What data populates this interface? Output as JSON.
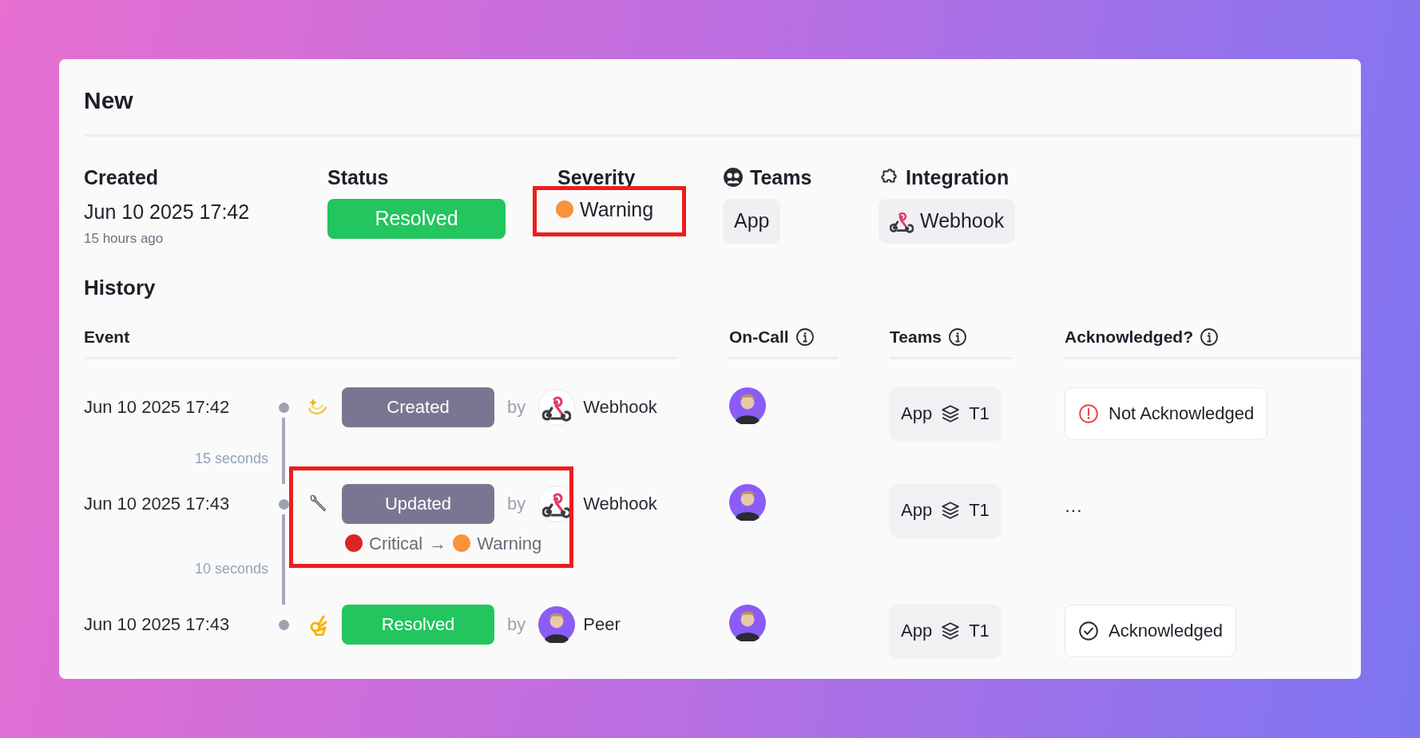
{
  "title": "New",
  "summary": {
    "created": {
      "label": "Created",
      "value": "Jun 10 2025 17:42",
      "relative": "15 hours ago"
    },
    "status": {
      "label": "Status",
      "value": "Resolved",
      "kind": "resolved"
    },
    "severity": {
      "label": "Severity",
      "value": "Warning",
      "color": "#fb923c",
      "highlighted": true
    },
    "teams": {
      "label": "Teams",
      "items": [
        "App"
      ]
    },
    "integration": {
      "label": "Integration",
      "value": "Webhook"
    }
  },
  "history": {
    "title": "History",
    "columns": [
      "Event",
      "On-Call",
      "Teams",
      "Acknowledged?"
    ],
    "events": [
      {
        "time": "Jun 10 2025 17:42",
        "kind": "created",
        "label": "Created",
        "by": "by",
        "actor": {
          "name": "Webhook",
          "kind": "webhook"
        },
        "team": "App",
        "tier": "T1",
        "acknowledgement": {
          "kind": "not_acknowledged",
          "text": "Not Acknowledged"
        },
        "highlighted": false,
        "gap_after": "15 seconds"
      },
      {
        "time": "Jun 10 2025 17:43",
        "kind": "updated",
        "label": "Updated",
        "by": "by",
        "actor": {
          "name": "Webhook",
          "kind": "webhook"
        },
        "change": {
          "from": {
            "label": "Critical",
            "color": "#dc2626"
          },
          "arrow": "→",
          "to": {
            "label": "Warning",
            "color": "#fb923c"
          }
        },
        "team": "App",
        "tier": "T1",
        "acknowledgement": {
          "kind": "pending",
          "text": "···"
        },
        "highlighted": true,
        "gap_after": "10 seconds"
      },
      {
        "time": "Jun 10 2025 17:43",
        "kind": "resolved",
        "label": "Resolved",
        "by": "by",
        "actor": {
          "name": "Peer",
          "kind": "person"
        },
        "team": "App",
        "tier": "T1",
        "acknowledgement": {
          "kind": "acknowledged",
          "text": "Acknowledged"
        },
        "highlighted": false
      }
    ]
  }
}
